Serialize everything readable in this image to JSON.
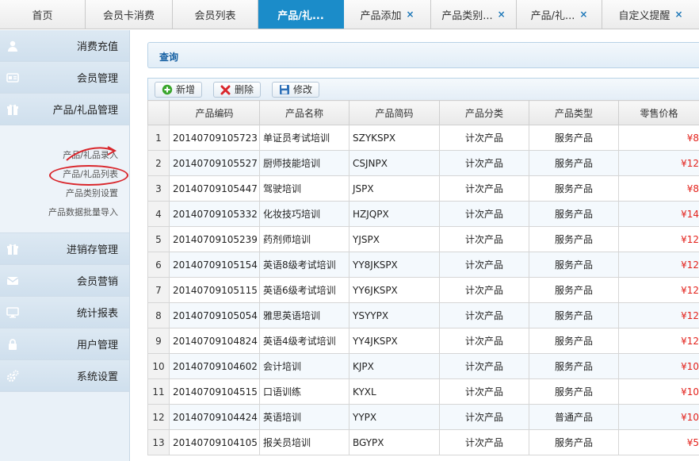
{
  "tabs": [
    {
      "label": "首页",
      "closable": false,
      "active": false
    },
    {
      "label": "会员卡消费",
      "closable": false,
      "active": false
    },
    {
      "label": "会员列表",
      "closable": false,
      "active": false
    },
    {
      "label": "产品/礼...",
      "closable": false,
      "active": true
    },
    {
      "label": "产品添加",
      "closable": true,
      "active": false
    },
    {
      "label": "产品类别...",
      "closable": true,
      "active": false
    },
    {
      "label": "产品/礼...",
      "closable": true,
      "active": false
    },
    {
      "label": "自定义提醒",
      "closable": true,
      "active": false
    }
  ],
  "close_glyph": "×",
  "sidebar": {
    "groups": [
      {
        "label": "消费充值",
        "icon": "person-icon"
      },
      {
        "label": "会员管理",
        "icon": "card-icon"
      },
      {
        "label": "产品/礼品管理",
        "icon": "gift-icon"
      },
      {
        "label": "进销存管理",
        "icon": "gift-icon"
      },
      {
        "label": "会员营销",
        "icon": "mail-icon"
      },
      {
        "label": "统计报表",
        "icon": "monitor-icon"
      },
      {
        "label": "用户管理",
        "icon": "lock-icon"
      },
      {
        "label": "系统设置",
        "icon": "gears-icon"
      }
    ],
    "submenu": [
      "产品/礼品录入",
      "产品/礼品列表",
      "产品类别设置",
      "产品数据批量导入"
    ]
  },
  "query": {
    "label": "查询"
  },
  "toolbar": {
    "add": "新增",
    "delete": "删除",
    "edit": "修改"
  },
  "table": {
    "headers": [
      "产品编码",
      "产品名称",
      "产品简码",
      "产品分类",
      "产品类型",
      "零售价格"
    ],
    "rows": [
      {
        "n": "1",
        "code": "20140709105723",
        "name": "单证员考试培训",
        "short": "SZYKSPX",
        "cat": "计次产品",
        "type": "服务产品",
        "price": "¥8"
      },
      {
        "n": "2",
        "code": "20140709105527",
        "name": "厨师技能培训",
        "short": "CSJNPX",
        "cat": "计次产品",
        "type": "服务产品",
        "price": "¥12"
      },
      {
        "n": "3",
        "code": "20140709105447",
        "name": "驾驶培训",
        "short": "JSPX",
        "cat": "计次产品",
        "type": "服务产品",
        "price": "¥8"
      },
      {
        "n": "4",
        "code": "20140709105332",
        "name": "化妆技巧培训",
        "short": "HZJQPX",
        "cat": "计次产品",
        "type": "服务产品",
        "price": "¥14"
      },
      {
        "n": "5",
        "code": "20140709105239",
        "name": "药剂师培训",
        "short": "YJSPX",
        "cat": "计次产品",
        "type": "服务产品",
        "price": "¥12"
      },
      {
        "n": "6",
        "code": "20140709105154",
        "name": "英语8级考试培训",
        "short": "YY8JKSPX",
        "cat": "计次产品",
        "type": "服务产品",
        "price": "¥12"
      },
      {
        "n": "7",
        "code": "20140709105115",
        "name": "英语6级考试培训",
        "short": "YY6JKSPX",
        "cat": "计次产品",
        "type": "服务产品",
        "price": "¥12"
      },
      {
        "n": "8",
        "code": "20140709105054",
        "name": "雅思英语培训",
        "short": "YSYYPX",
        "cat": "计次产品",
        "type": "服务产品",
        "price": "¥12"
      },
      {
        "n": "9",
        "code": "20140709104824",
        "name": "英语4级考试培训",
        "short": "YY4JKSPX",
        "cat": "计次产品",
        "type": "服务产品",
        "price": "¥12"
      },
      {
        "n": "10",
        "code": "20140709104602",
        "name": "会计培训",
        "short": "KJPX",
        "cat": "计次产品",
        "type": "服务产品",
        "price": "¥10"
      },
      {
        "n": "11",
        "code": "20140709104515",
        "name": "口语训练",
        "short": "KYXL",
        "cat": "计次产品",
        "type": "服务产品",
        "price": "¥10"
      },
      {
        "n": "12",
        "code": "20140709104424",
        "name": "英语培训",
        "short": "YYPX",
        "cat": "计次产品",
        "type": "普通产品",
        "price": "¥10"
      },
      {
        "n": "13",
        "code": "20140709104105",
        "name": "报关员培训",
        "short": "BGYPX",
        "cat": "计次产品",
        "type": "服务产品",
        "price": "¥5"
      }
    ]
  },
  "colors": {
    "accent": "#1b8cc9",
    "price": "#e3221c",
    "annotation": "#d9262c"
  }
}
